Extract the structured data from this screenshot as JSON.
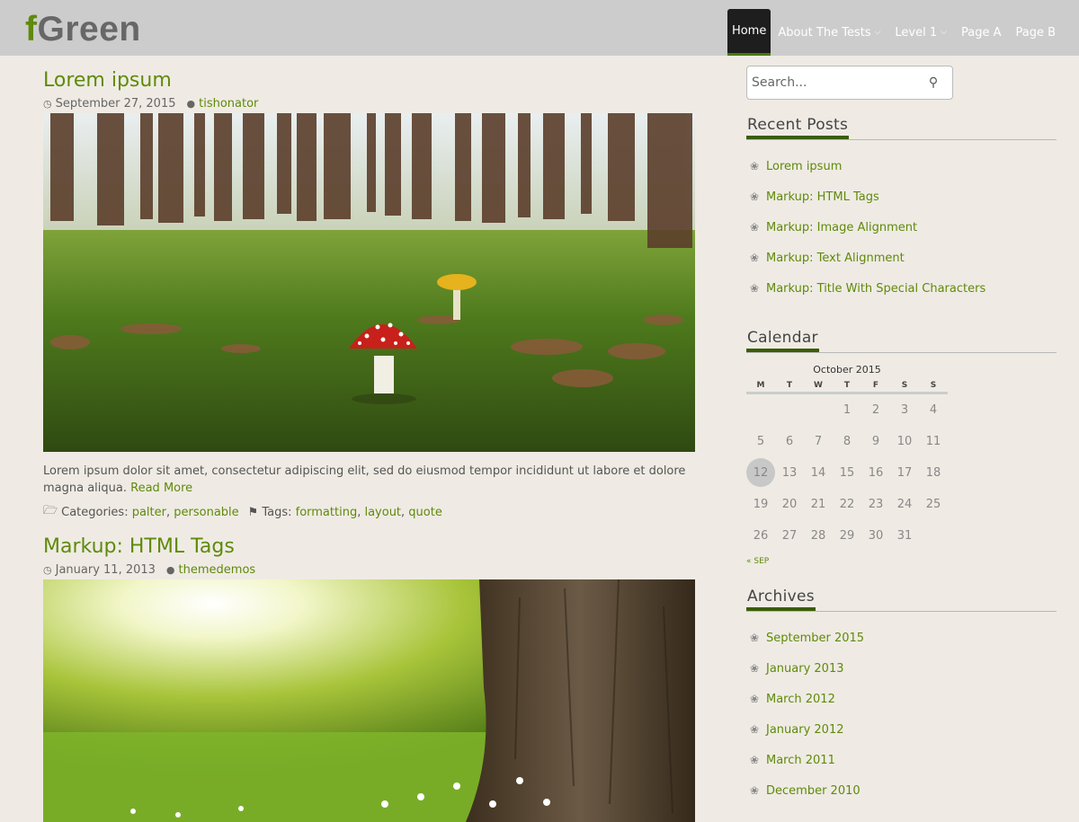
{
  "brand": {
    "prefix": "f",
    "rest": "Green"
  },
  "nav": {
    "home": "Home",
    "about": "About The Tests",
    "level1": "Level 1",
    "pageA": "Page A",
    "pageB": "Page B"
  },
  "posts": [
    {
      "title": "Lorem ipsum",
      "date": "September 27, 2015",
      "author": "tishonator",
      "excerpt": "Lorem ipsum dolor sit amet, consectetur adipiscing elit, sed do eiusmod tempor incididunt ut labore et dolore magna aliqua.",
      "read_more": "Read More",
      "categories_label": "Categories:",
      "cat1": "palter",
      "cat2": "personable",
      "tags_label": "Tags:",
      "tag1": "formatting",
      "tag2": "layout",
      "tag3": "quote"
    },
    {
      "title": "Markup: HTML Tags",
      "date": "January 11, 2013",
      "author": "themedemos"
    }
  ],
  "sidebar": {
    "search_placeholder": "Search...",
    "recent_title": "Recent Posts",
    "recent": [
      "Lorem ipsum",
      "Markup: HTML Tags",
      "Markup: Image Alignment",
      "Markup: Text Alignment",
      "Markup: Title With Special Characters"
    ],
    "calendar_title": "Calendar",
    "calendar_caption": "October 2015",
    "weekdays": [
      "M",
      "T",
      "W",
      "T",
      "F",
      "S",
      "S"
    ],
    "today": "12",
    "prev_link": "« SEP",
    "archives_title": "Archives",
    "archives": [
      "September 2015",
      "January 2013",
      "March 2012",
      "January 2012",
      "March 2011",
      "December 2010"
    ]
  },
  "colors": {
    "accent": "#5f8a0a",
    "header_bg": "#cccccc",
    "page_bg": "#efebe4"
  }
}
